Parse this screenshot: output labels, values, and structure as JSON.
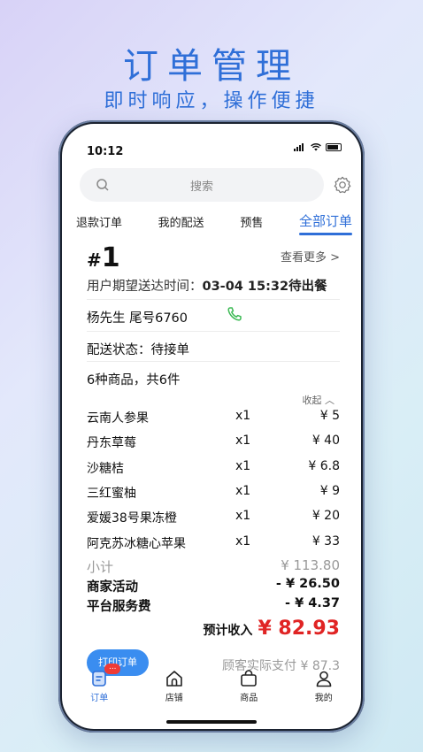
{
  "promo": {
    "title": "订单管理",
    "subtitle": "即时响应，操作便捷"
  },
  "status_bar": {
    "time": "10:12"
  },
  "search": {
    "placeholder": "搜索"
  },
  "tabs": [
    {
      "label": "退款订单",
      "active": false
    },
    {
      "label": "我的配送",
      "active": false
    },
    {
      "label": "预售",
      "active": false
    },
    {
      "label": "全部订单",
      "active": true
    }
  ],
  "order": {
    "hash_symbol": "#",
    "number": "1",
    "more_link": "查看更多 >",
    "expected_label": "用户期望送达时间：",
    "expected_time": "03-04 15:32",
    "status": "待出餐",
    "customer": "杨先生  尾号6760",
    "delivery_status": "配送状态：待接单",
    "count_text": "6种商品，共6件",
    "collapse_label": "收起",
    "items": [
      {
        "name": "云南人参果",
        "qty": "x1",
        "price": "¥ 5"
      },
      {
        "name": "丹东草莓",
        "qty": "x1",
        "price": "¥ 40"
      },
      {
        "name": "沙糖桔",
        "qty": "x1",
        "price": "¥ 6.8"
      },
      {
        "name": "三红蜜柚",
        "qty": "x1",
        "price": "¥ 9"
      },
      {
        "name": "爱媛38号果冻橙",
        "qty": "x1",
        "price": "¥ 20"
      },
      {
        "name": "阿克苏冰糖心苹果",
        "qty": "x1",
        "price": "¥ 33"
      }
    ],
    "subtotal_label": "小计",
    "subtotal_value": "¥ 113.80",
    "promo_label": "商家活动",
    "promo_value": "- ¥ 26.50",
    "fee_label": "平台服务费",
    "fee_value": "- ¥ 4.37",
    "income_label": "预计收入",
    "income_value": "¥ 82.93",
    "print_label": "打印订单",
    "paid_text": "顾客实际支付 ¥ 87.3"
  },
  "bottom_nav": [
    {
      "label": "订单",
      "icon": "order-icon",
      "active": true,
      "badge": "..."
    },
    {
      "label": "店铺",
      "icon": "shop-icon",
      "active": false
    },
    {
      "label": "商品",
      "icon": "goods-icon",
      "active": false
    },
    {
      "label": "我的",
      "icon": "profile-icon",
      "active": false
    }
  ],
  "colors": {
    "accent": "#2f6fd8",
    "income": "#e02424",
    "button": "#3a8df0",
    "badge": "#ef3b36"
  }
}
